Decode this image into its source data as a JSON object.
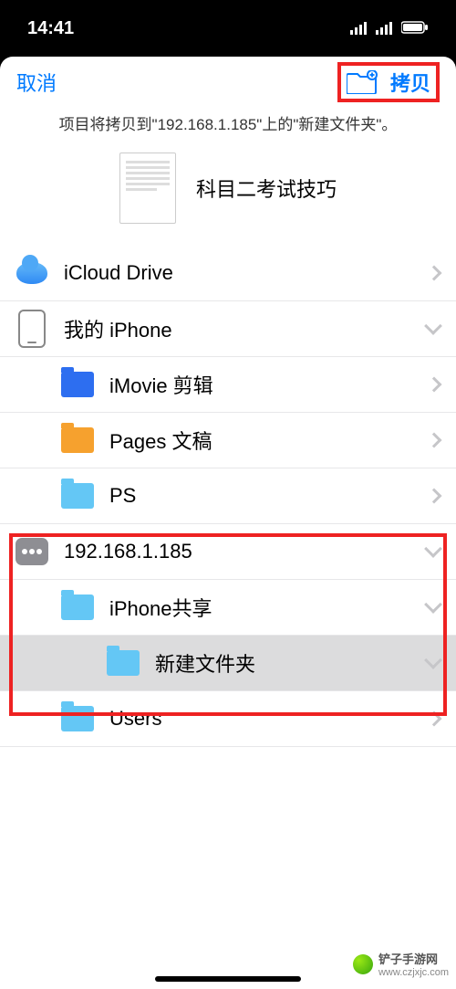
{
  "status": {
    "time": "14:41"
  },
  "header": {
    "cancel": "取消",
    "copy": "拷贝"
  },
  "subtitle": "项目将拷贝到\"192.168.1.185\"上的\"新建文件夹\"。",
  "file": {
    "name": "科目二考试技巧"
  },
  "rows": {
    "icloud": "iCloud Drive",
    "myiphone": "我的 iPhone",
    "imovie": "iMovie 剪辑",
    "pages": "Pages 文稿",
    "ps": "PS",
    "server": "192.168.1.185",
    "iphoneshare": "iPhone共享",
    "newfolder": "新建文件夹",
    "users": "Users"
  },
  "watermark": {
    "text": "铲子手游网",
    "url": "www.czjxjc.com"
  }
}
